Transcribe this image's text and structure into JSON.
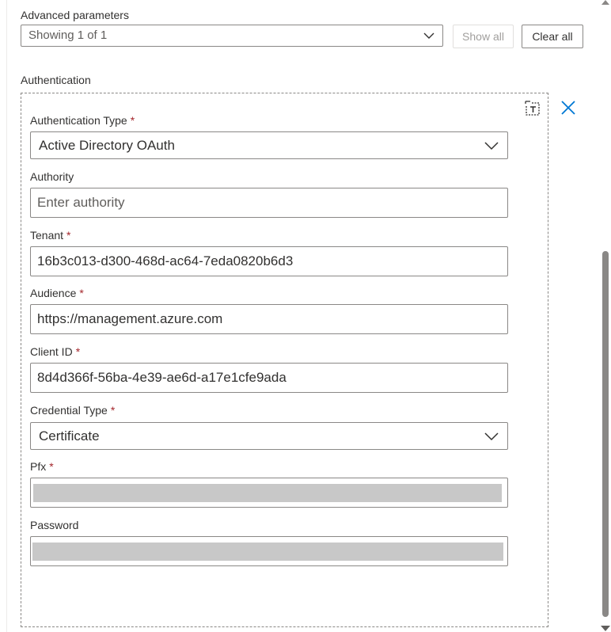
{
  "advanced": {
    "label": "Advanced parameters",
    "select_value": "Showing 1 of 1",
    "show_all": "Show all",
    "clear_all": "Clear all"
  },
  "auth": {
    "section_label": "Authentication",
    "type_label": "Authentication Type",
    "type_value": "Active Directory OAuth",
    "authority_label": "Authority",
    "authority_placeholder": "Enter authority",
    "tenant_label": "Tenant",
    "tenant_value": "16b3c013-d300-468d-ac64-7eda0820b6d3",
    "audience_label": "Audience",
    "audience_value": "https://management.azure.com",
    "client_id_label": "Client ID",
    "client_id_value": "8d4d366f-56ba-4e39-ae6d-a17e1cfe9ada",
    "credential_type_label": "Credential Type",
    "credential_type_value": "Certificate",
    "pfx_label": "Pfx",
    "password_label": "Password",
    "required_marker": "*"
  },
  "icons": {
    "token": "dynamic-content-icon",
    "close": "close-icon",
    "chevron": "chevron-down-icon"
  },
  "colors": {
    "accent": "#0078d4",
    "required": "#a4262c",
    "border": "#8a8886",
    "disabled_text": "#a19f9d"
  }
}
